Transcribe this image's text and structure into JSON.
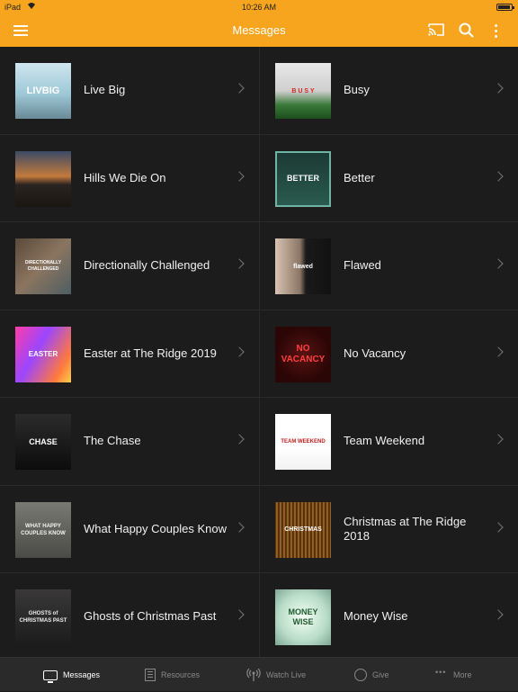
{
  "status_bar": {
    "carrier": "iPad",
    "time": "10:26 AM",
    "battery_level": 0.9
  },
  "navbar": {
    "title": "Messages",
    "icons": [
      "menu-icon",
      "cast-icon",
      "search-icon",
      "more-vert-icon"
    ]
  },
  "messages": [
    {
      "title": "Live Big",
      "thumb_text": "LIVBIG",
      "thumb_style": "livebig"
    },
    {
      "title": "Busy",
      "thumb_text": "B U S Y",
      "thumb_style": "busy"
    },
    {
      "title": "Hills We Die On",
      "thumb_text": "",
      "thumb_style": "hills"
    },
    {
      "title": "Better",
      "thumb_text": "BETTER",
      "thumb_style": "better"
    },
    {
      "title": "Directionally Challenged",
      "thumb_text": "DIRECTIONALLY CHALLENGED",
      "thumb_style": "directional"
    },
    {
      "title": "Flawed",
      "thumb_text": "flawed",
      "thumb_style": "flawed"
    },
    {
      "title": "Easter at The Ridge 2019",
      "thumb_text": "EASTER",
      "thumb_style": "easter"
    },
    {
      "title": "No Vacancy",
      "thumb_text": "NO VACANCY",
      "thumb_style": "novacancy"
    },
    {
      "title": "The Chase",
      "thumb_text": "CHASE",
      "thumb_style": "chase"
    },
    {
      "title": "Team Weekend",
      "thumb_text": "TEAM WEEKEND",
      "thumb_style": "team"
    },
    {
      "title": "What Happy Couples Know",
      "thumb_text": "WHAT HAPPY COUPLES KNOW",
      "thumb_style": "couples"
    },
    {
      "title": "Christmas at The Ridge 2018",
      "thumb_text": "CHRISTMAS",
      "thumb_style": "christmas"
    },
    {
      "title": "Ghosts of Christmas Past",
      "thumb_text": "GHOSTS of CHRISTMAS PAST",
      "thumb_style": "ghosts"
    },
    {
      "title": "Money Wise",
      "thumb_text": "MONEY WISE",
      "thumb_style": "money"
    }
  ],
  "tabs": [
    {
      "label": "Messages",
      "icon": "monitor-icon",
      "active": true
    },
    {
      "label": "Resources",
      "icon": "document-icon",
      "active": false
    },
    {
      "label": "Watch Live",
      "icon": "broadcast-icon",
      "active": false
    },
    {
      "label": "Give",
      "icon": "globe-icon",
      "active": false
    },
    {
      "label": "More",
      "icon": "more-horiz-icon",
      "active": false
    }
  ]
}
